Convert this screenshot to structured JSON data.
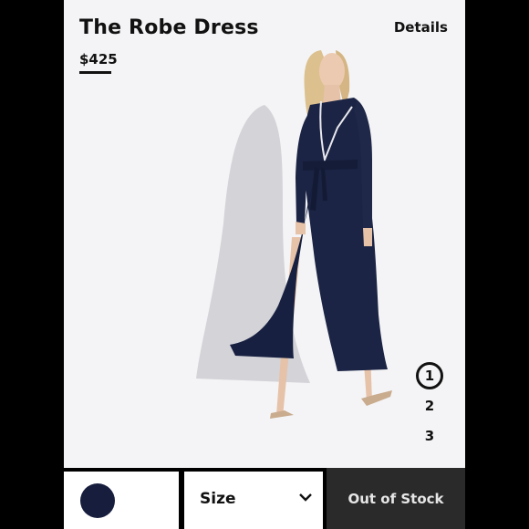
{
  "product": {
    "title": "The Robe Dress",
    "price": "$425",
    "details_label": "Details"
  },
  "gallery": {
    "pages": [
      "1",
      "2",
      "3"
    ],
    "active_page": "1",
    "image_icon": "model-wearing-robe-dress-image"
  },
  "bottom_bar": {
    "swatch_color": "#161d3d",
    "size_label": "Size",
    "stock_label": "Out of Stock"
  }
}
